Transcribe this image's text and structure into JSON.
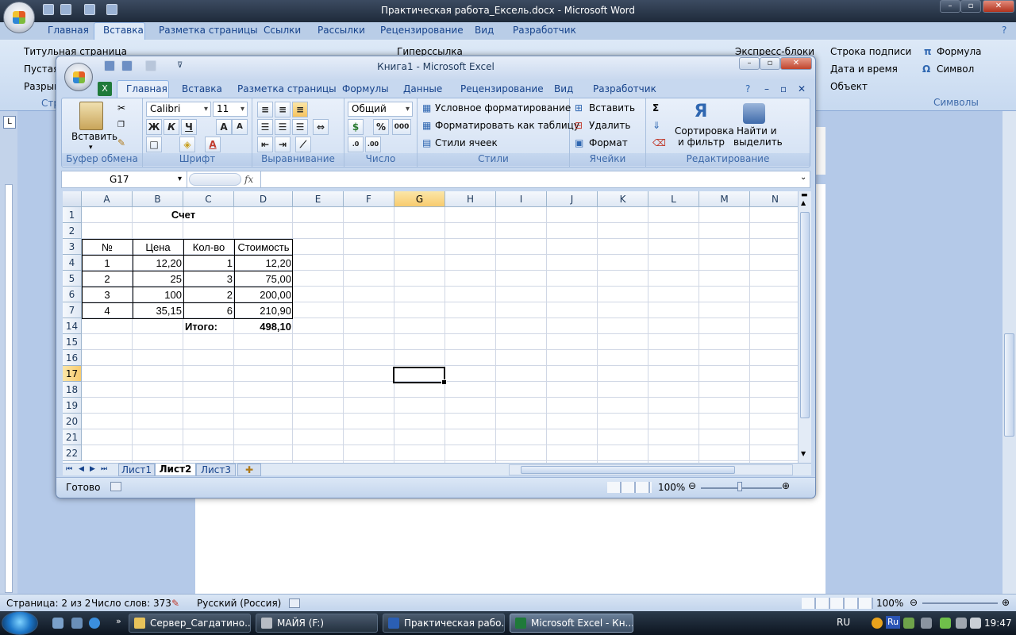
{
  "word": {
    "title": "Практическая работа_Ексель.docx - Microsoft Word",
    "tabs": [
      "Главная",
      "Вставка",
      "Разметка страницы",
      "Ссылки",
      "Рассылки",
      "Рецензирование",
      "Вид",
      "Разработчик"
    ],
    "active_tab": "Вставка",
    "ribbon": {
      "title_page": "Титульная страница",
      "blank_page": "Пустая",
      "page_break": "Разрыв",
      "hyperlink": "Гиперссылка",
      "quick_parts": "Экспресс-блоки",
      "signature_line": "Строка подписи",
      "date_time": "Дата и время",
      "object": "Объект",
      "formula": "Формула",
      "symbol": "Символ",
      "group_pages_fragment": "Стр",
      "group_symbols": "Символы"
    },
    "status": {
      "page": "Страница: 2 из 2",
      "words": "Число слов: 373",
      "language": "Русский (Россия)",
      "zoom": "100%"
    }
  },
  "taskbar": {
    "buttons": [
      "Сервер_Сагдатино...",
      "МАЙЯ (F:)",
      "Практическая рабо...",
      "Microsoft Excel - Кн..."
    ],
    "language": "RU",
    "tray_lang": "Ru",
    "clock": "19:47"
  },
  "excel": {
    "title": "Книга1 - Microsoft Excel",
    "tabs": [
      "Главная",
      "Вставка",
      "Разметка страницы",
      "Формулы",
      "Данные",
      "Рецензирование",
      "Вид",
      "Разработчик"
    ],
    "active_tab": "Главная",
    "ribbon": {
      "paste": "Вставить",
      "group_clipboard": "Буфер обмена",
      "font_name": "Calibri",
      "font_size": "11",
      "bold": "Ж",
      "italic": "К",
      "underline": "Ч",
      "group_font": "Шрифт",
      "group_alignment": "Выравнивание",
      "number_format": "Общий",
      "percent": "%",
      "thousands": "000",
      "group_number": "Число",
      "conditional_formatting": "Условное форматирование",
      "format_as_table": "Форматировать как таблицу",
      "cell_styles": "Стили ячеек",
      "group_styles": "Стили",
      "insert": "Вставить",
      "delete": "Удалить",
      "format": "Формат",
      "group_cells": "Ячейки",
      "sum": "Σ",
      "sort_filter_1": "Сортировка",
      "sort_filter_2": "и фильтр",
      "find_select_1": "Найти и",
      "find_select_2": "выделить",
      "group_editing": "Редактирование"
    },
    "name_box": "G17",
    "fx": "fx",
    "columns": [
      "A",
      "B",
      "C",
      "D",
      "E",
      "F",
      "G",
      "H",
      "I",
      "J",
      "K",
      "L",
      "M",
      "N"
    ],
    "rows": [
      "1",
      "2",
      "3",
      "4",
      "5",
      "6",
      "7",
      "14",
      "15",
      "16",
      "17",
      "18",
      "19",
      "20",
      "21",
      "22"
    ],
    "selected_column": "G",
    "selected_row": "17",
    "cells": {
      "title": "Счет",
      "headers": [
        "№",
        "Цена",
        "Кол-во",
        "Стоимость"
      ],
      "data": [
        [
          "1",
          "12,20",
          "1",
          "12,20"
        ],
        [
          "2",
          "25",
          "3",
          "75,00"
        ],
        [
          "3",
          "100",
          "2",
          "200,00"
        ],
        [
          "4",
          "35,15",
          "6",
          "210,90"
        ]
      ],
      "total_label": "Итого:",
      "total_value": "498,10"
    },
    "sheets": [
      "Лист1",
      "Лист2",
      "Лист3"
    ],
    "active_sheet": "Лист2",
    "status": {
      "ready": "Готово",
      "zoom": "100%"
    }
  }
}
